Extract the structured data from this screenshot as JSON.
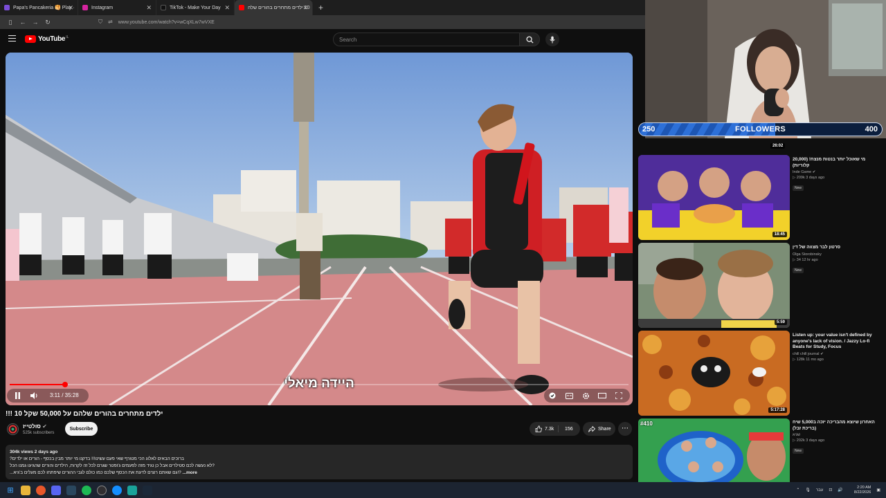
{
  "browser": {
    "tabs": [
      {
        "label": "Papa's Pancakeria 🥞 Play ·",
        "color": "#7a4dd6"
      },
      {
        "label": "Instagram",
        "color": "#d6249f"
      },
      {
        "label": "TikTok - Make Your Day",
        "color": "#111111"
      },
      {
        "label": "10 ילדים מתחרים בהורים שלה",
        "color": "#ff0000"
      }
    ],
    "active_tab": 3,
    "url": "www.youtube.com/watch?v=wCqXLw7wVXE"
  },
  "youtube": {
    "logo_text": "YouTube",
    "logo_suffix": "IL",
    "search_placeholder": "Search"
  },
  "video": {
    "subtitle": "היידה מיאלי",
    "current_time": "3:11",
    "total_time": "35:28",
    "time_display": "3:11 / 35:28",
    "progress_fraction": 0.09
  },
  "meta": {
    "title": "!!! 10 ילדים מתחרים בהורים שלהם על 50,000 שקל",
    "channel": "סולטייז",
    "subscribers": "525k subscribers",
    "subscribe_label": "Subscribe",
    "likes": "7.3k",
    "comments": "156",
    "share_label": "Share",
    "views_date": "304k views  2 days ago",
    "desc_line1": "ברוכים הבאים לאלוג הכי מטורף שאי פעם עשינו!!! בדקנו מי יותר מבין בכסף - הורים או ילדים?",
    "desc_line2": "?לא נעשה לכם סטילרים אבל כן נגיד מזה לפעמים ג'ופטר שגרם לכל זה לקרות, הילדים והורים שהגיעו גמנו הכל",
    "desc_line3": "...more",
    "desc_line3_prefix": "...גם שאתם רוצים לדעת את הכסף שלכם כמו כולם לגבי ההורים שיפתחו לכם מעלים ב'גיא!?"
  },
  "stream": {
    "bar_label": "FOLLOWERS",
    "bar_min": "250",
    "bar_max": "400",
    "bar_fraction": 0.56,
    "webcam_duration": "26:02"
  },
  "recommendations": [
    {
      "title": "מי שאוכל יותר בנטות מנצח! (20,000 קלוריות)",
      "channel": "Inde Game",
      "meta": "209k  3 days ago",
      "badge": "New",
      "duration": "18:45"
    },
    {
      "title": "סרטון לבר מצווה של דין",
      "channel": "Olga Storobinsky",
      "meta": "34  12 hr ago",
      "badge": "New",
      "duration": "5:59"
    },
    {
      "title": "Listen up: your value isn't defined by anyone's lack of vision. / Jazzy Lo-fi Beats for Study, Focus",
      "channel": "chill chill journal",
      "meta": "128k  11 mo ago",
      "badge": "",
      "duration": "5:17:28"
    },
    {
      "title": "האחרון שיוצא מהבריכה יזכה ב5,000 שיח (בריכת זבל)",
      "channel": "שגיא",
      "meta": "202k  3 days ago",
      "badge": "New",
      "duration": "",
      "number_badge": "#410"
    }
  ],
  "taskbar": {
    "time": "2:20 AM",
    "date": "8/22/2026",
    "lang": "עבר"
  }
}
